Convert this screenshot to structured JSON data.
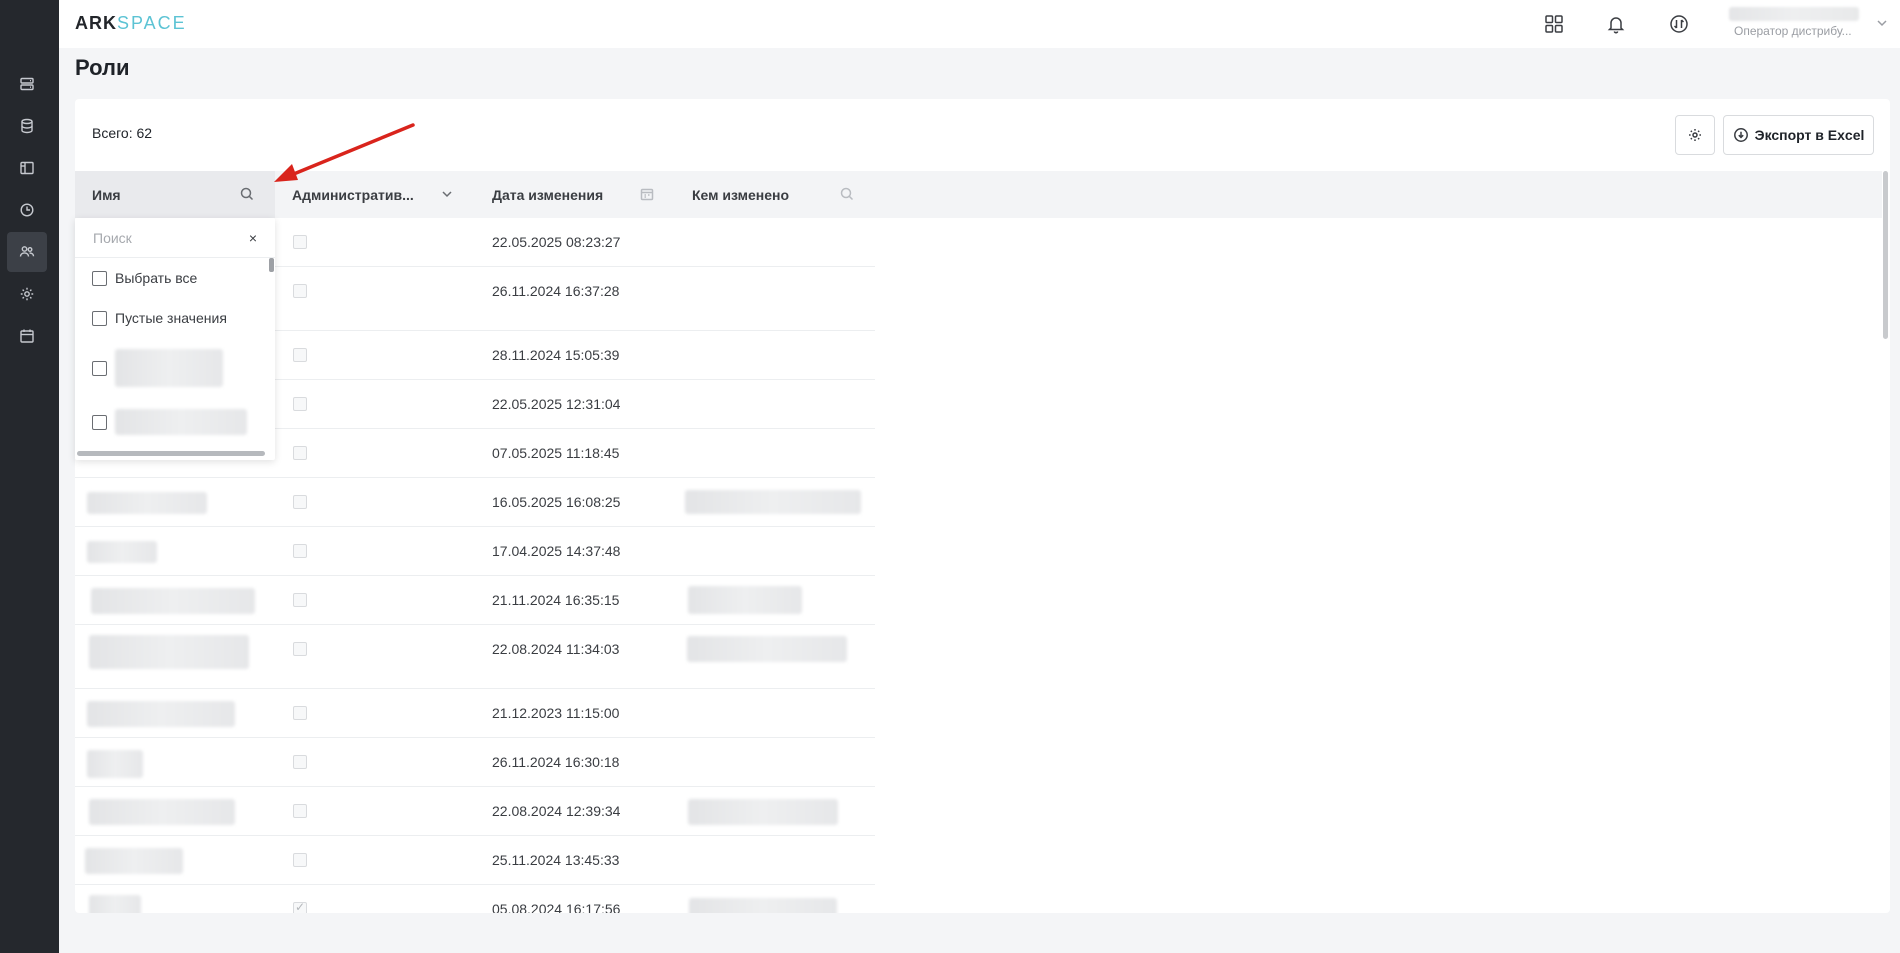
{
  "app": {
    "logo_ark": "ARK",
    "logo_space": "SPACE"
  },
  "user": {
    "role": "Оператор дистрибу..."
  },
  "page": {
    "title": "Роли"
  },
  "toolbar": {
    "total_label": "Всего: 62",
    "export_label": "Экспорт в Excel"
  },
  "columns": {
    "name": "Имя",
    "admin": "Административ...",
    "date": "Дата изменения",
    "changed_by": "Кем изменено"
  },
  "filter": {
    "placeholder": "Поиск",
    "clear": "×",
    "select_all": "Выбрать все",
    "empty_values": "Пустые значения"
  },
  "rows": [
    {
      "date": "22.05.2025 08:23:27",
      "admin": false
    },
    {
      "date": "26.11.2024 16:37:28",
      "admin": false
    },
    {
      "date": "28.11.2024 15:05:39",
      "admin": false
    },
    {
      "date": "22.05.2025 12:31:04",
      "admin": false
    },
    {
      "date": "07.05.2025 11:18:45",
      "admin": false
    },
    {
      "date": "16.05.2025 16:08:25",
      "admin": false
    },
    {
      "date": "17.04.2025 14:37:48",
      "admin": false
    },
    {
      "date": "21.11.2024 16:35:15",
      "admin": false
    },
    {
      "date": "22.08.2024 11:34:03",
      "admin": false
    },
    {
      "date": "21.12.2023 11:15:00",
      "admin": false
    },
    {
      "date": "26.11.2024 16:30:18",
      "admin": false
    },
    {
      "date": "22.08.2024 12:39:34",
      "admin": false
    },
    {
      "date": "25.11.2024 13:45:33",
      "admin": false
    },
    {
      "date": "05.08.2024 16:17:56",
      "admin": true
    }
  ],
  "icons": {
    "sidebar": [
      "server-icon",
      "database-icon",
      "layout-icon",
      "clock-icon",
      "users-icon",
      "gear-icon",
      "calendar-icon"
    ],
    "top": [
      "apps-grid-icon",
      "bell-icon",
      "sync-icon"
    ]
  },
  "colors": {
    "sidebar_bg": "#25282d",
    "accent": "#5cc3d4",
    "arrow": "#d9241c"
  }
}
